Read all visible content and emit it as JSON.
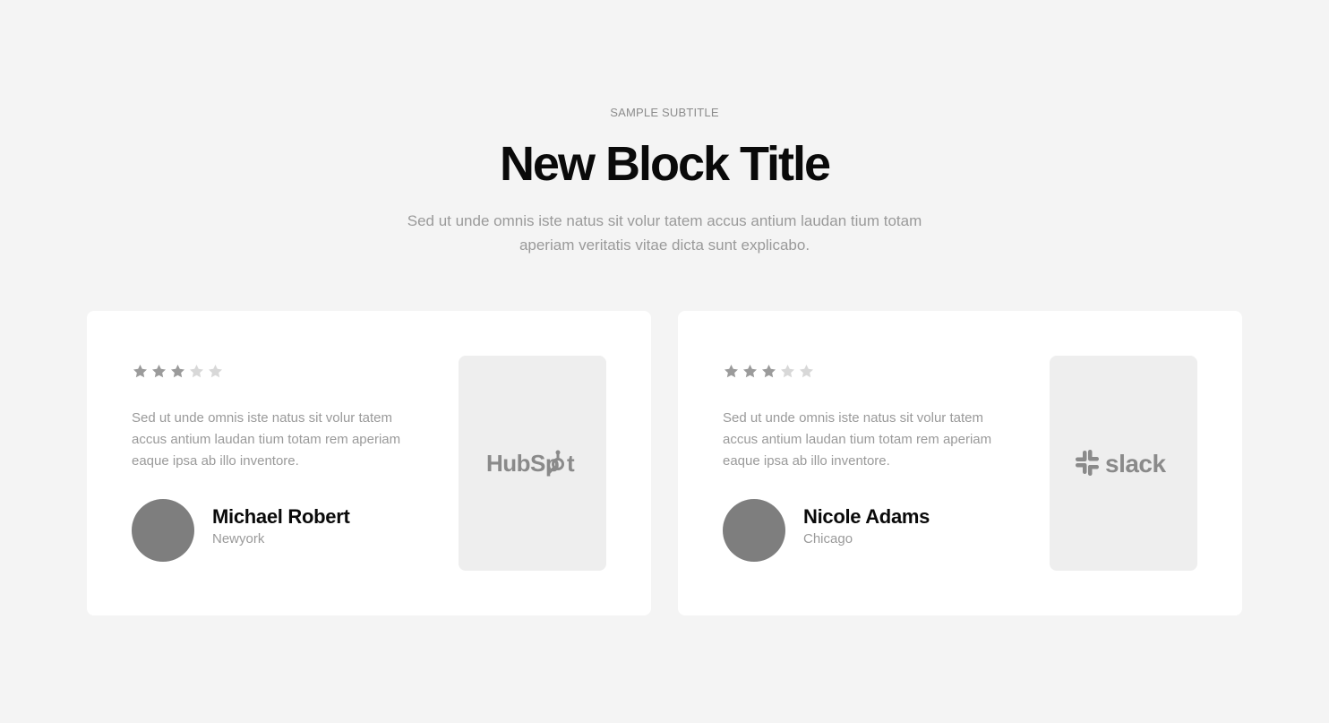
{
  "header": {
    "subtitle": "SAMPLE SUBTITLE",
    "title": "New Block Title",
    "lead": "Sed ut unde omnis iste natus sit volur tatem accus antium laudan tium totam aperiam veritatis vitae dicta sunt explicabo."
  },
  "colors": {
    "background": "#f4f4f4",
    "card": "#ffffff",
    "logo_box": "#eeeeee",
    "star_on": "#9b9b9b",
    "star_off": "#d8d8d8",
    "avatar": "#7e7e7e"
  },
  "testimonials": [
    {
      "rating": 3,
      "max_rating": 5,
      "quote": "Sed ut unde omnis iste natus sit volur tatem accus antium laudan tium totam rem aperiam eaque ipsa ab illo inventore.",
      "name": "Michael Robert",
      "city": "Newyork",
      "logo": "HubSpot",
      "logo_icon": "hubspot-logo"
    },
    {
      "rating": 3,
      "max_rating": 5,
      "quote": "Sed ut unde omnis iste natus sit volur tatem accus antium laudan tium totam rem aperiam eaque ipsa ab illo inventore.",
      "name": "Nicole Adams",
      "city": "Chicago",
      "logo": "slack",
      "logo_icon": "slack-logo"
    }
  ]
}
